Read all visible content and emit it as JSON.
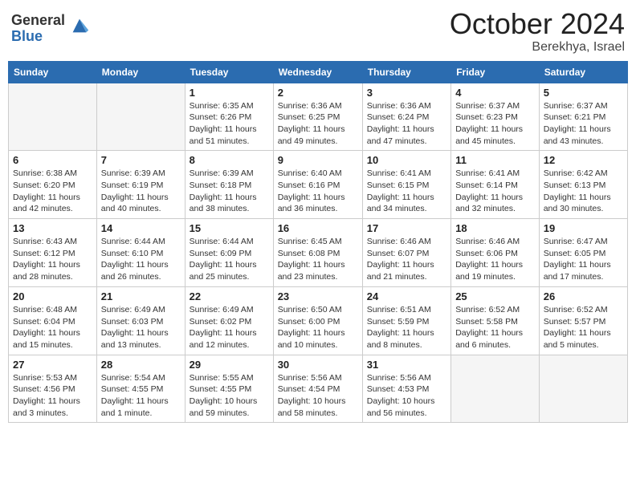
{
  "logo": {
    "general": "General",
    "blue": "Blue"
  },
  "header": {
    "month": "October 2024",
    "location": "Berekhya, Israel"
  },
  "weekdays": [
    "Sunday",
    "Monday",
    "Tuesday",
    "Wednesday",
    "Thursday",
    "Friday",
    "Saturday"
  ],
  "weeks": [
    [
      {
        "day": "",
        "sunrise": "",
        "sunset": "",
        "daylight": "",
        "empty": true
      },
      {
        "day": "",
        "sunrise": "",
        "sunset": "",
        "daylight": "",
        "empty": true
      },
      {
        "day": "1",
        "sunrise": "Sunrise: 6:35 AM",
        "sunset": "Sunset: 6:26 PM",
        "daylight": "Daylight: 11 hours and 51 minutes.",
        "empty": false
      },
      {
        "day": "2",
        "sunrise": "Sunrise: 6:36 AM",
        "sunset": "Sunset: 6:25 PM",
        "daylight": "Daylight: 11 hours and 49 minutes.",
        "empty": false
      },
      {
        "day": "3",
        "sunrise": "Sunrise: 6:36 AM",
        "sunset": "Sunset: 6:24 PM",
        "daylight": "Daylight: 11 hours and 47 minutes.",
        "empty": false
      },
      {
        "day": "4",
        "sunrise": "Sunrise: 6:37 AM",
        "sunset": "Sunset: 6:23 PM",
        "daylight": "Daylight: 11 hours and 45 minutes.",
        "empty": false
      },
      {
        "day": "5",
        "sunrise": "Sunrise: 6:37 AM",
        "sunset": "Sunset: 6:21 PM",
        "daylight": "Daylight: 11 hours and 43 minutes.",
        "empty": false
      }
    ],
    [
      {
        "day": "6",
        "sunrise": "Sunrise: 6:38 AM",
        "sunset": "Sunset: 6:20 PM",
        "daylight": "Daylight: 11 hours and 42 minutes.",
        "empty": false
      },
      {
        "day": "7",
        "sunrise": "Sunrise: 6:39 AM",
        "sunset": "Sunset: 6:19 PM",
        "daylight": "Daylight: 11 hours and 40 minutes.",
        "empty": false
      },
      {
        "day": "8",
        "sunrise": "Sunrise: 6:39 AM",
        "sunset": "Sunset: 6:18 PM",
        "daylight": "Daylight: 11 hours and 38 minutes.",
        "empty": false
      },
      {
        "day": "9",
        "sunrise": "Sunrise: 6:40 AM",
        "sunset": "Sunset: 6:16 PM",
        "daylight": "Daylight: 11 hours and 36 minutes.",
        "empty": false
      },
      {
        "day": "10",
        "sunrise": "Sunrise: 6:41 AM",
        "sunset": "Sunset: 6:15 PM",
        "daylight": "Daylight: 11 hours and 34 minutes.",
        "empty": false
      },
      {
        "day": "11",
        "sunrise": "Sunrise: 6:41 AM",
        "sunset": "Sunset: 6:14 PM",
        "daylight": "Daylight: 11 hours and 32 minutes.",
        "empty": false
      },
      {
        "day": "12",
        "sunrise": "Sunrise: 6:42 AM",
        "sunset": "Sunset: 6:13 PM",
        "daylight": "Daylight: 11 hours and 30 minutes.",
        "empty": false
      }
    ],
    [
      {
        "day": "13",
        "sunrise": "Sunrise: 6:43 AM",
        "sunset": "Sunset: 6:12 PM",
        "daylight": "Daylight: 11 hours and 28 minutes.",
        "empty": false
      },
      {
        "day": "14",
        "sunrise": "Sunrise: 6:44 AM",
        "sunset": "Sunset: 6:10 PM",
        "daylight": "Daylight: 11 hours and 26 minutes.",
        "empty": false
      },
      {
        "day": "15",
        "sunrise": "Sunrise: 6:44 AM",
        "sunset": "Sunset: 6:09 PM",
        "daylight": "Daylight: 11 hours and 25 minutes.",
        "empty": false
      },
      {
        "day": "16",
        "sunrise": "Sunrise: 6:45 AM",
        "sunset": "Sunset: 6:08 PM",
        "daylight": "Daylight: 11 hours and 23 minutes.",
        "empty": false
      },
      {
        "day": "17",
        "sunrise": "Sunrise: 6:46 AM",
        "sunset": "Sunset: 6:07 PM",
        "daylight": "Daylight: 11 hours and 21 minutes.",
        "empty": false
      },
      {
        "day": "18",
        "sunrise": "Sunrise: 6:46 AM",
        "sunset": "Sunset: 6:06 PM",
        "daylight": "Daylight: 11 hours and 19 minutes.",
        "empty": false
      },
      {
        "day": "19",
        "sunrise": "Sunrise: 6:47 AM",
        "sunset": "Sunset: 6:05 PM",
        "daylight": "Daylight: 11 hours and 17 minutes.",
        "empty": false
      }
    ],
    [
      {
        "day": "20",
        "sunrise": "Sunrise: 6:48 AM",
        "sunset": "Sunset: 6:04 PM",
        "daylight": "Daylight: 11 hours and 15 minutes.",
        "empty": false
      },
      {
        "day": "21",
        "sunrise": "Sunrise: 6:49 AM",
        "sunset": "Sunset: 6:03 PM",
        "daylight": "Daylight: 11 hours and 13 minutes.",
        "empty": false
      },
      {
        "day": "22",
        "sunrise": "Sunrise: 6:49 AM",
        "sunset": "Sunset: 6:02 PM",
        "daylight": "Daylight: 11 hours and 12 minutes.",
        "empty": false
      },
      {
        "day": "23",
        "sunrise": "Sunrise: 6:50 AM",
        "sunset": "Sunset: 6:00 PM",
        "daylight": "Daylight: 11 hours and 10 minutes.",
        "empty": false
      },
      {
        "day": "24",
        "sunrise": "Sunrise: 6:51 AM",
        "sunset": "Sunset: 5:59 PM",
        "daylight": "Daylight: 11 hours and 8 minutes.",
        "empty": false
      },
      {
        "day": "25",
        "sunrise": "Sunrise: 6:52 AM",
        "sunset": "Sunset: 5:58 PM",
        "daylight": "Daylight: 11 hours and 6 minutes.",
        "empty": false
      },
      {
        "day": "26",
        "sunrise": "Sunrise: 6:52 AM",
        "sunset": "Sunset: 5:57 PM",
        "daylight": "Daylight: 11 hours and 5 minutes.",
        "empty": false
      }
    ],
    [
      {
        "day": "27",
        "sunrise": "Sunrise: 5:53 AM",
        "sunset": "Sunset: 4:56 PM",
        "daylight": "Daylight: 11 hours and 3 minutes.",
        "empty": false
      },
      {
        "day": "28",
        "sunrise": "Sunrise: 5:54 AM",
        "sunset": "Sunset: 4:55 PM",
        "daylight": "Daylight: 11 hours and 1 minute.",
        "empty": false
      },
      {
        "day": "29",
        "sunrise": "Sunrise: 5:55 AM",
        "sunset": "Sunset: 4:55 PM",
        "daylight": "Daylight: 10 hours and 59 minutes.",
        "empty": false
      },
      {
        "day": "30",
        "sunrise": "Sunrise: 5:56 AM",
        "sunset": "Sunset: 4:54 PM",
        "daylight": "Daylight: 10 hours and 58 minutes.",
        "empty": false
      },
      {
        "day": "31",
        "sunrise": "Sunrise: 5:56 AM",
        "sunset": "Sunset: 4:53 PM",
        "daylight": "Daylight: 10 hours and 56 minutes.",
        "empty": false
      },
      {
        "day": "",
        "sunrise": "",
        "sunset": "",
        "daylight": "",
        "empty": true
      },
      {
        "day": "",
        "sunrise": "",
        "sunset": "",
        "daylight": "",
        "empty": true
      }
    ]
  ]
}
